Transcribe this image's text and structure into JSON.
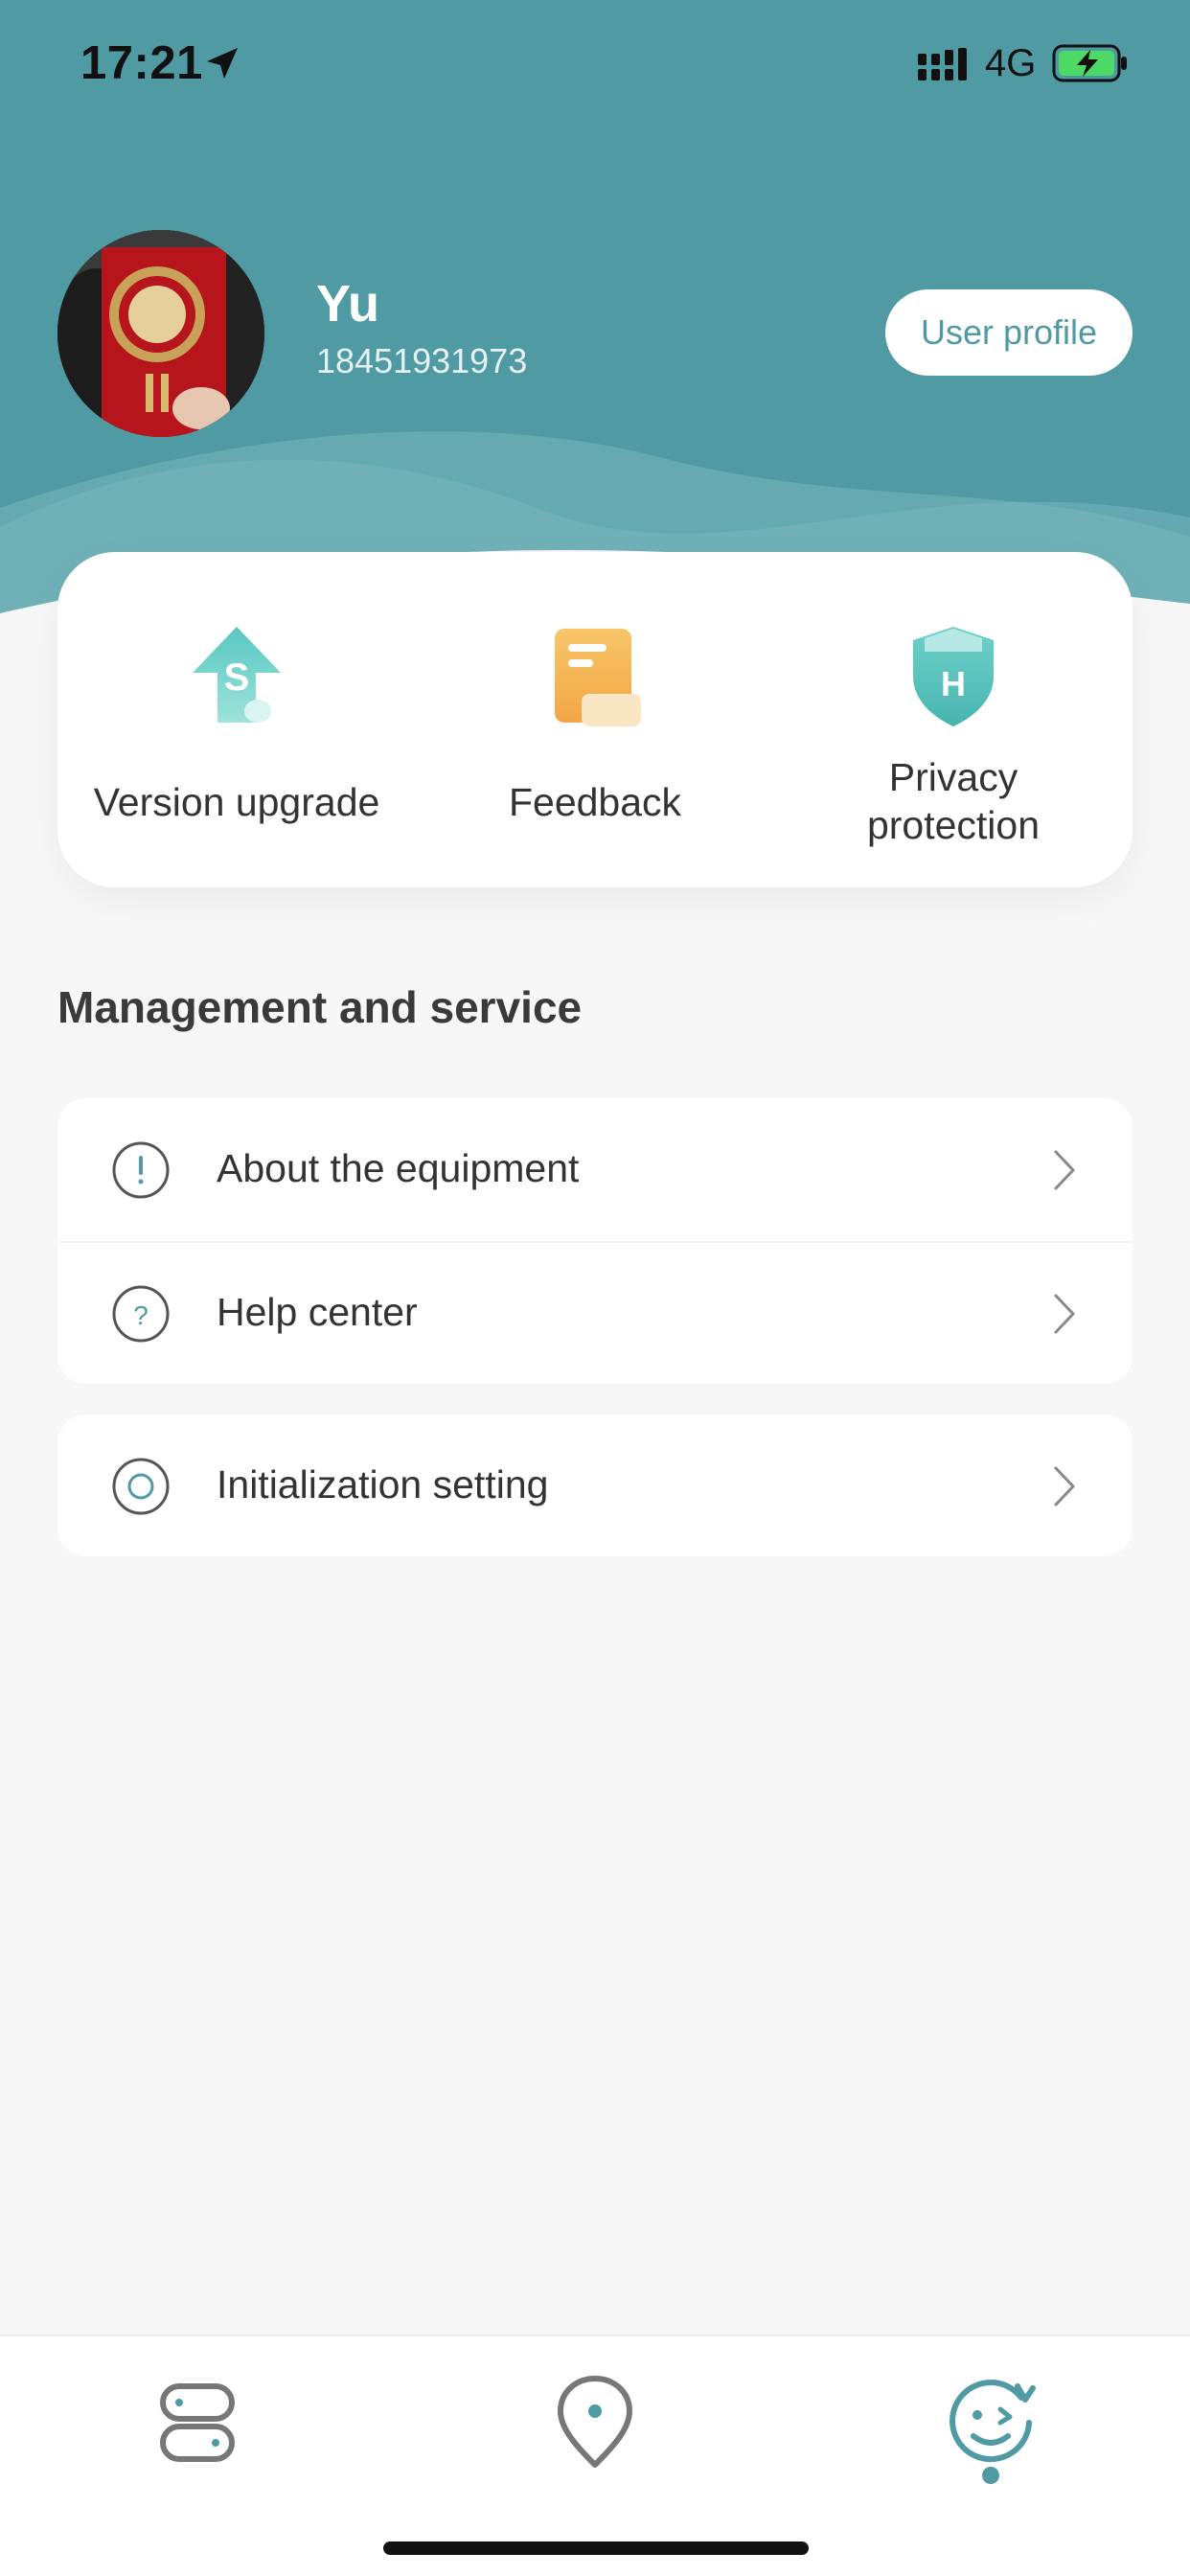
{
  "status_bar": {
    "time": "17:21",
    "network": "4G",
    "battery_color": "#4cd964"
  },
  "profile": {
    "name": "Yu",
    "phone": "18451931973",
    "profile_button_label": "User profile"
  },
  "quick_actions": [
    {
      "label": "Version upgrade",
      "icon": "upgrade-icon"
    },
    {
      "label": "Feedback",
      "icon": "feedback-icon"
    },
    {
      "label_line1": "Privacy",
      "label_line2": "protection",
      "icon": "shield-icon"
    }
  ],
  "management": {
    "title": "Management and service",
    "items": [
      {
        "label": "About the equipment",
        "icon": "info-icon"
      },
      {
        "label": "Help center",
        "icon": "help-icon"
      },
      {
        "label": "Initialization setting",
        "icon": "reset-icon"
      }
    ]
  },
  "tab_bar": {
    "tabs": [
      {
        "icon": "devices-icon"
      },
      {
        "icon": "location-icon"
      },
      {
        "icon": "profile-face-icon",
        "active": true
      }
    ]
  },
  "colors": {
    "accent": "#4f9aa3",
    "background": "#f7f7f7",
    "card": "#ffffff"
  }
}
